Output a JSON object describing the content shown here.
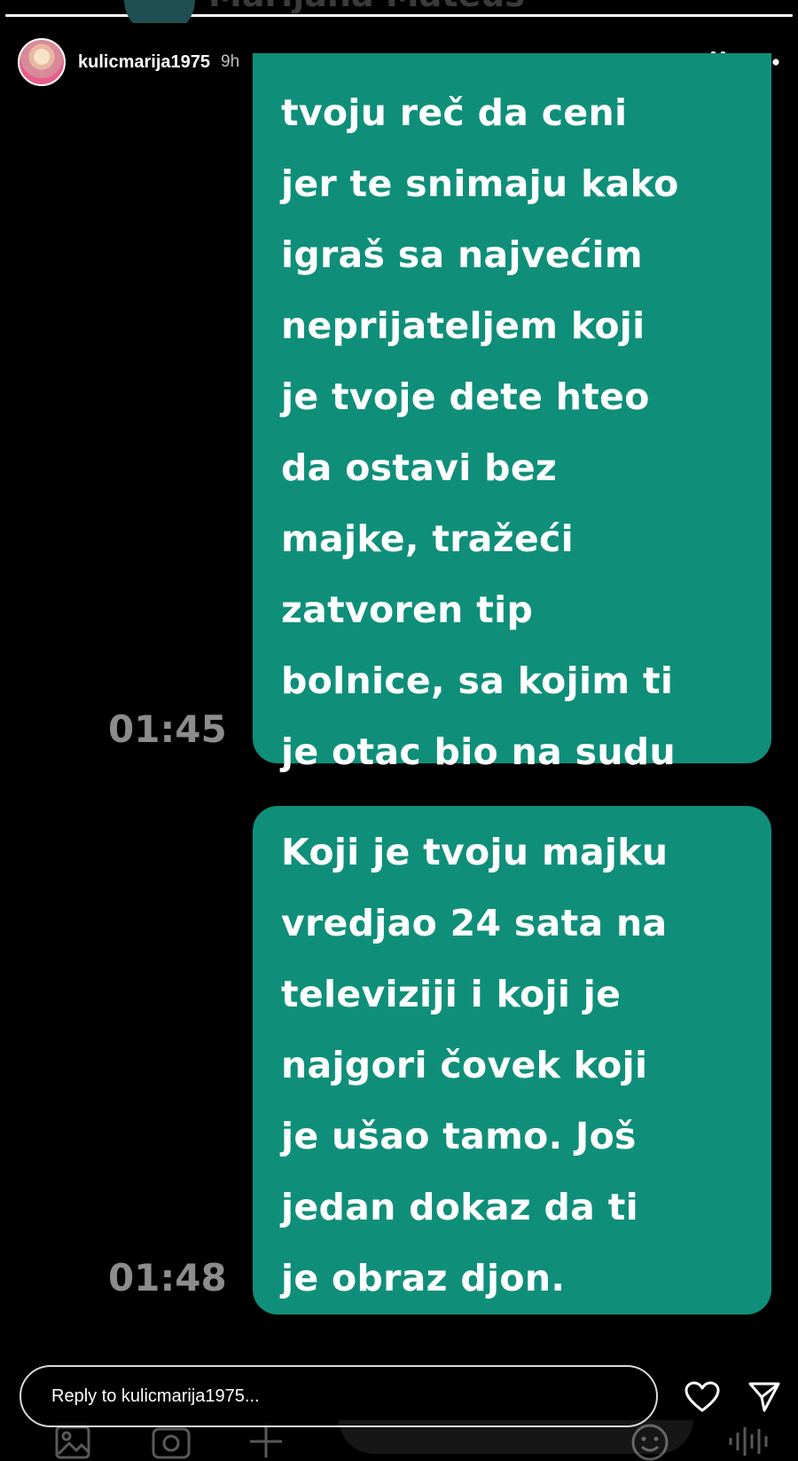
{
  "story": {
    "progress_segments": 1,
    "progress_value": 1.0,
    "username": "kulicmarija1975",
    "time_ago": "9h"
  },
  "ghost_header": {
    "name": "Marijana Mateus"
  },
  "messages": [
    {
      "text": "tvoju reč da ceni\njer te snimaju kako\nigraš sa najvećim\nneprijateljem koji\nje tvoje dete hteo\nda ostavi bez\nmajke, tražeći\nzatvoren tip\nbolnice, sa kojim ti\nje otac bio na sudu",
      "time": "01:45"
    },
    {
      "text": "Koji je tvoju majku\nvredjao 24 sata na\nteleviziji i koji je\nnajgori čovek koji\nje ušao tamo. Još\njedan dokaz da ti\nje obraz djon.",
      "time": "01:48"
    }
  ],
  "reply": {
    "placeholder": "Reply to kulicmarija1975..."
  },
  "icons": {
    "pause": "pause-icon",
    "more": "more-icon",
    "heart": "heart-icon",
    "send": "send-icon",
    "gallery": "gallery-icon",
    "camera": "camera-icon",
    "plus": "plus-icon",
    "emoji": "emoji-icon",
    "voice": "voice-icon"
  },
  "colors": {
    "background": "#000000",
    "bubble": "#0f8f79",
    "timestamp": "#8c8c8c",
    "text": "#ffffff"
  }
}
